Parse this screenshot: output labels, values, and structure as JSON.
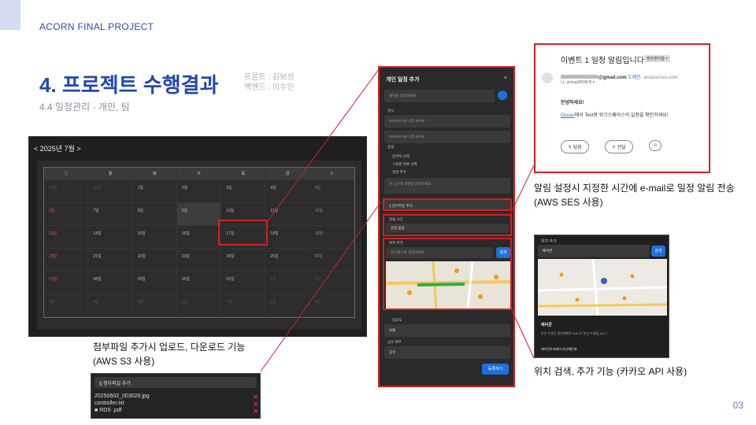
{
  "header": {
    "brand": "ACORN FINAL PROJECT",
    "title": "4. 프로젝트 수행결과",
    "credit_front": "프론트 : 김보성",
    "credit_back": "백엔드 : 이수민",
    "subtitle": "4.4 일정관리 - 개인, 팀",
    "page_number": "03"
  },
  "calendar": {
    "nav": "< 2025년 7월 >",
    "weekdays": [
      "일",
      "월",
      "화",
      "수",
      "목",
      "금",
      "토"
    ],
    "rows": [
      [
        "29일",
        "30일",
        "1일",
        "2일",
        "3일",
        "4일",
        "5일"
      ],
      [
        "6일",
        "7일",
        "8일",
        "9일",
        "10일",
        "11일",
        "12일"
      ],
      [
        "13일",
        "14일",
        "15일",
        "16일",
        "17일",
        "18일",
        "19일"
      ],
      [
        "20일",
        "21일",
        "22일",
        "23일",
        "24일",
        "25일",
        "26일"
      ],
      [
        "27일",
        "28일",
        "29일",
        "30일",
        "31일",
        "1일",
        "2일"
      ],
      [
        "3일",
        "4일",
        "5일",
        "6일",
        "7일",
        "8일",
        "9일"
      ]
    ]
  },
  "modal": {
    "title": "개인 일정 추가",
    "close": "×",
    "title_placeholder": "제목을 입력하세요",
    "datetime_label": "일시",
    "start": "2025-07-09 오전 09:00",
    "end": "2025-07-09 오후 06:00",
    "allday_label": "종일",
    "color_label": "참석자 선택",
    "add_member_label": "구성원 목록 선택",
    "desc_label": "설명 추가",
    "desc_placeholder": "이 시간에 설명을 입력하세요",
    "attach_button": "첨부파일 추가",
    "alarm_label": "알림 시간",
    "alarm_value": "알림 없음",
    "location_label": "위치 추가",
    "location_placeholder": "장소명으로 검색하세요",
    "search_button": "검색",
    "importance_label": "중요도",
    "importance_value": "보통",
    "share_label": "공유 여부",
    "share_value": "공유",
    "submit_button": "등록하기"
  },
  "email": {
    "subject": "이벤트 1 일정 알림입니다",
    "tag": "받은편지함 ×",
    "sender_suffix": "@gmail.com",
    "sender_domain_label": "도메인:",
    "sender_domain": "amazonses.com",
    "recipient": "나, victoai999에게 ▾",
    "greeting": "안녕하세요!",
    "body_link": "Ocean",
    "body_text": "에서 Test용 워크스페이스의 일정을 확인하세요!",
    "reply": "답장",
    "forward": "전달"
  },
  "desc_email": "알림 설정시 지정한 시간에 e-mail로 일정 알림 전송",
  "desc_email_sub": "(AWS SES 사용)",
  "place": {
    "title": "위치 추가",
    "query": "에이콘",
    "search_button": "검색",
    "result_name": "에이콘",
    "result_addr": "부산 수영구 광안해변로 255 1F 부산 수영점 447-7",
    "result2": "에이콘아카데미 부산해운대"
  },
  "desc_place": "위치 검색, 추가 기능 (카카오 API 사용)",
  "desc_attach": "첨부파일 추가시 업로드, 다운로드 기능",
  "desc_attach_sub": "(AWS S3 사용)",
  "attach": {
    "header": "첨부파일 추가",
    "files": [
      "20250602_003028.jpg",
      "controller.txt",
      "RDS .pdf"
    ]
  }
}
